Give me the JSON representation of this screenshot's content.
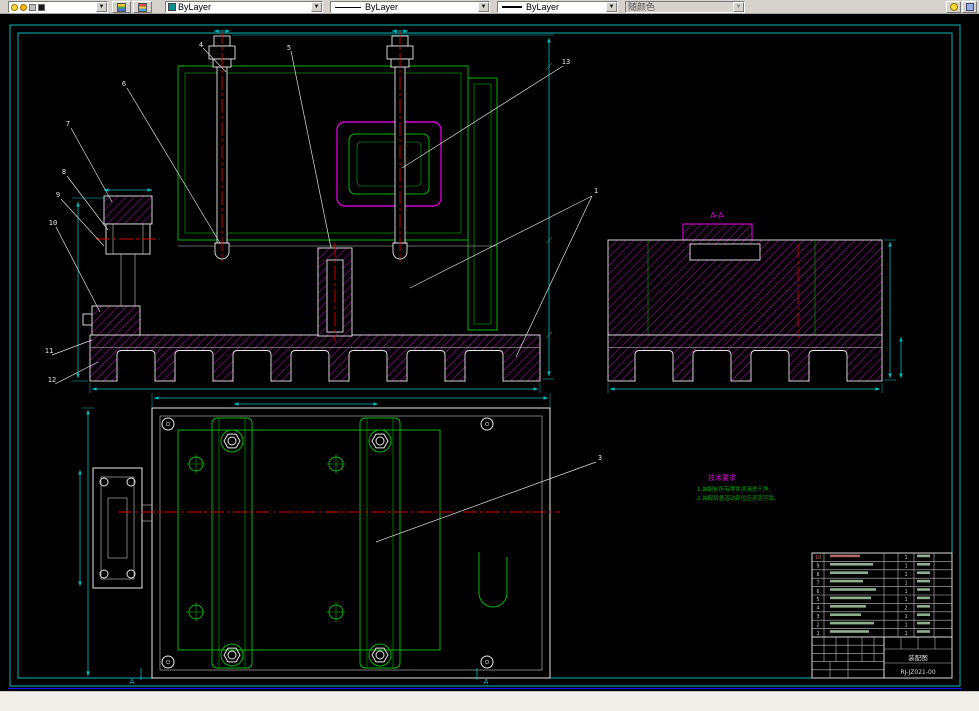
{
  "toolbar": {
    "color_control": {
      "value": "ByLayer"
    },
    "linetype_control": {
      "value": "ByLayer"
    },
    "lineweight_control": {
      "value": "ByLayer"
    },
    "plotstyle_control": {
      "value": "随颜色",
      "disabled": true
    }
  },
  "drawing": {
    "section_label": "A-A",
    "cut_labels": {
      "left": "A",
      "right": "A"
    },
    "tech_requirements": {
      "title": "技术要求",
      "lines": [
        "1.装配前所有零件须清洗干净;",
        "2.装配后各活动部位应灵活可靠。"
      ]
    },
    "callouts": [
      {
        "n": "4"
      },
      {
        "n": "5"
      },
      {
        "n": "13"
      },
      {
        "n": "6"
      },
      {
        "n": "7"
      },
      {
        "n": "8"
      },
      {
        "n": "9"
      },
      {
        "n": "10"
      },
      {
        "n": "11"
      },
      {
        "n": "12"
      },
      {
        "n": "1"
      },
      {
        "n": "3"
      }
    ],
    "title_block": {
      "bom_rows": [
        {
          "no": "10",
          "qty": "1"
        },
        {
          "no": "9",
          "qty": "1"
        },
        {
          "no": "8",
          "qty": "1"
        },
        {
          "no": "7",
          "qty": "1"
        },
        {
          "no": "6",
          "qty": "1"
        },
        {
          "no": "5",
          "qty": "1"
        },
        {
          "no": "4",
          "qty": "2"
        },
        {
          "no": "3",
          "qty": "1"
        },
        {
          "no": "2",
          "qty": "1"
        },
        {
          "no": "1",
          "qty": "1"
        }
      ],
      "name": "装配图",
      "drawing_no": "RJ-JZ021-00"
    },
    "colors": {
      "magenta": "#cf00cf",
      "green": "#00b400",
      "cyan": "#00c0c0",
      "red": "#d40000",
      "white": "#e8e8e8",
      "frame_cyan": "#00b8b8",
      "border_blue": "#1414e6"
    }
  }
}
